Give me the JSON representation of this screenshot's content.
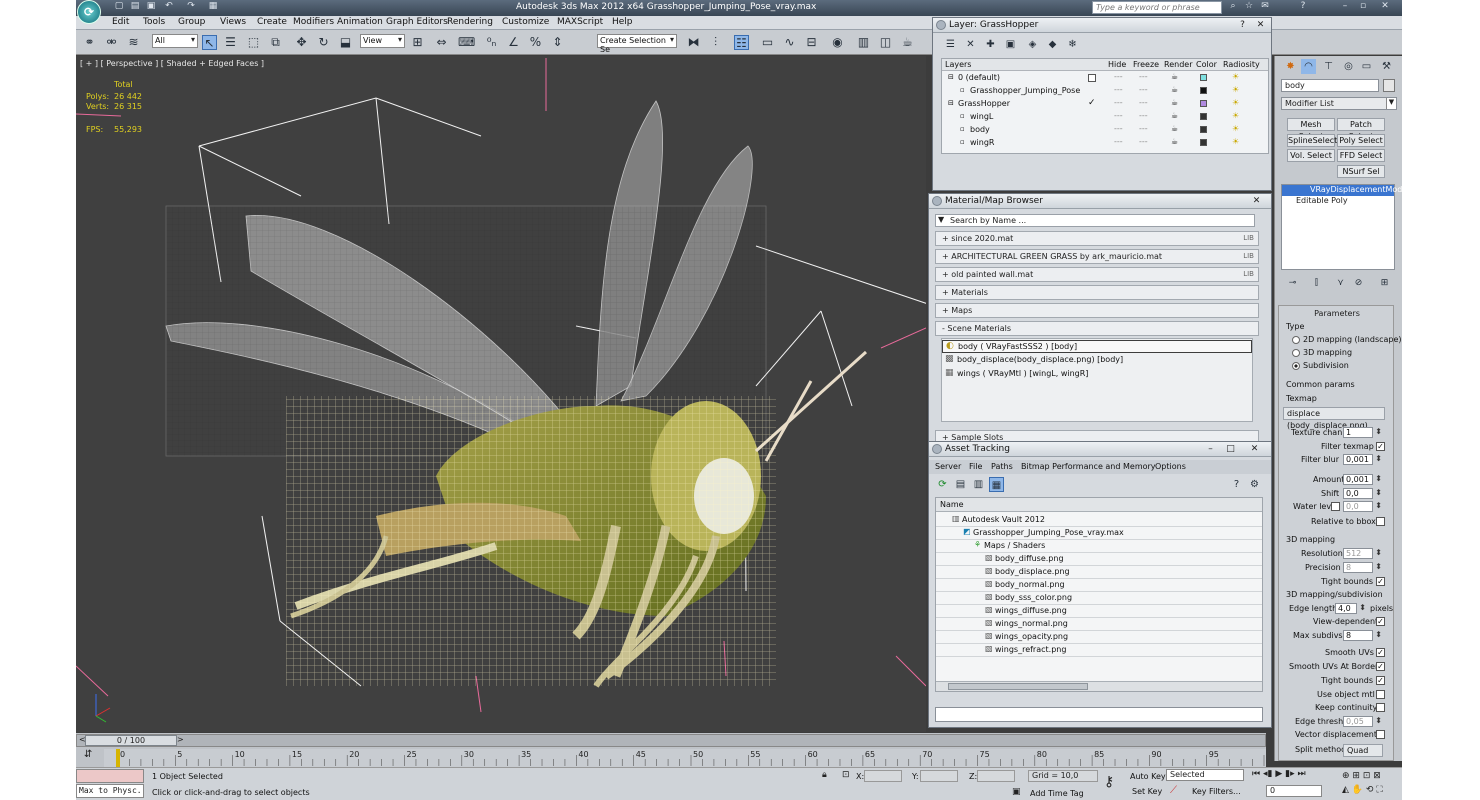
{
  "window": {
    "title": "Autodesk 3ds Max  2012 x64     Grasshopper_Jumping_Pose_vray.max",
    "search_placeholder": "Type a keyword or phrase"
  },
  "menu": [
    "Edit",
    "Tools",
    "Group",
    "Views",
    "Create",
    "Modifiers",
    "Animation",
    "Graph Editors",
    "Rendering",
    "Customize",
    "MAXScript",
    "Help"
  ],
  "toolbar": {
    "filter": "All",
    "coord": "View",
    "selection_set": "Create Selection Se"
  },
  "viewport": {
    "label": "[ + ] [ Perspective ] [ Shaded + Edged Faces ]",
    "stats_header": "Total",
    "polys_label": "Polys:",
    "polys_value": "26 442",
    "verts_label": "Verts:",
    "verts_value": "26 315",
    "fps_label": "FPS:",
    "fps_value": "55,293"
  },
  "layer_panel": {
    "title": "Layer: GrassHopper",
    "columns": [
      "Layers",
      "Hide",
      "Freeze",
      "Render",
      "Color",
      "Radiosity"
    ],
    "rows": [
      {
        "name": "0 (default)",
        "indent": 0,
        "color": "#7fe0e0"
      },
      {
        "name": "Grasshopper_Jumping_Pose",
        "indent": 1,
        "color": "#111111"
      },
      {
        "name": "GrassHopper",
        "indent": 0,
        "color": "#b08ae0"
      },
      {
        "name": "wingL",
        "indent": 1,
        "color": "#333333"
      },
      {
        "name": "body",
        "indent": 1,
        "color": "#333333"
      },
      {
        "name": "wingR",
        "indent": 1,
        "color": "#333333"
      }
    ]
  },
  "material_browser": {
    "title": "Material/Map Browser",
    "search": "Search by Name ...",
    "groups": [
      {
        "label": "+ since 2020.mat",
        "tag": "LIB"
      },
      {
        "label": "+ ARCHITECTURAL GREEN GRASS by ark_mauricio.mat",
        "tag": "LIB"
      },
      {
        "label": "+ old painted wall.mat",
        "tag": "LIB"
      },
      {
        "label": "+ Materials",
        "tag": ""
      },
      {
        "label": "+ Maps",
        "tag": ""
      },
      {
        "label": "- Scene Materials",
        "tag": ""
      }
    ],
    "scene_materials": [
      "body  ( VRayFastSSS2 )  [body]",
      "body_displace(body_displace.png) [body]",
      "wings  ( VRayMtl )  [wingL, wingR]"
    ],
    "sample_slots": "+ Sample Slots"
  },
  "asset_tracking": {
    "title": "Asset Tracking",
    "menu": [
      "Server",
      "File",
      "Paths",
      "Bitmap Performance and Memory",
      "Options"
    ],
    "column": "Name",
    "tree": [
      {
        "name": "Autodesk Vault 2012",
        "indent": 0
      },
      {
        "name": "Grasshopper_Jumping_Pose_vray.max",
        "indent": 1
      },
      {
        "name": "Maps / Shaders",
        "indent": 2
      },
      {
        "name": "body_diffuse.png",
        "indent": 3
      },
      {
        "name": "body_displace.png",
        "indent": 3
      },
      {
        "name": "body_normal.png",
        "indent": 3
      },
      {
        "name": "body_sss_color.png",
        "indent": 3
      },
      {
        "name": "wings_diffuse.png",
        "indent": 3
      },
      {
        "name": "wings_normal.png",
        "indent": 3
      },
      {
        "name": "wings_opacity.png",
        "indent": 3
      },
      {
        "name": "wings_refract.png",
        "indent": 3
      }
    ]
  },
  "command_panel": {
    "object_name": "body",
    "modifier_list": "Modifier List",
    "buttons": [
      "Mesh Select",
      "Patch Select",
      "SplineSelect",
      "Poly Select",
      "Vol. Select",
      "FFD Select",
      "NSurf Sel"
    ],
    "stack": [
      "VRayDisplacementMod",
      "Editable Poly"
    ],
    "parameters": {
      "title": "Parameters",
      "type_label": "Type",
      "type_options": [
        "2D mapping (landscape)",
        "3D mapping",
        "Subdivision"
      ],
      "selected_type": 2,
      "common_params": "Common params",
      "texmap": "Texmap",
      "texmap_value": "displace (body_displace.png)",
      "texture_chan": "Texture chan",
      "texture_chan_value": "1",
      "filter_texmap": "Filter texmap",
      "filter_blur": "Filter blur",
      "filter_blur_value": "0,001",
      "amount": "Amount",
      "amount_value": "0,001",
      "shift": "Shift",
      "shift_value": "0,0",
      "water_level": "Water level",
      "water_level_value": "0,0",
      "relative_bbox": "Relative to bbox",
      "mapping_3d": "3D mapping",
      "resolution": "Resolution",
      "resolution_value": "512",
      "precision": "Precision",
      "precision_value": "8",
      "tight_bounds": "Tight bounds",
      "subdivision": "3D mapping/subdivision",
      "edge_length": "Edge length",
      "edge_length_value": "4,0",
      "pixels": "pixels",
      "view_dependent": "View-dependent",
      "max_subdivs": "Max subdivs",
      "max_subdivs_value": "8",
      "smooth_uvs": "Smooth UVs",
      "smooth_uvs_borders": "Smooth UVs At Borders",
      "tight_bounds2": "Tight bounds",
      "use_object_mtl": "Use object mtl",
      "keep_continuity": "Keep continuity",
      "edge_thresh": "Edge thresh",
      "edge_thresh_value": "0,05",
      "vector_displacement": "Vector displacement",
      "split_method": "Split method",
      "split_method_value": "Quad"
    }
  },
  "timeline": {
    "frame": "0 / 100",
    "ticks": [
      "0",
      "5",
      "10",
      "15",
      "20",
      "25",
      "30",
      "35",
      "40",
      "45",
      "50",
      "55",
      "60",
      "65",
      "70",
      "75",
      "80",
      "85",
      "90",
      "95",
      "100"
    ]
  },
  "status": {
    "script_label": "Max to Physc.",
    "selected": "1 Object Selected",
    "prompt": "Click or click-and-drag to select objects",
    "x_label": "X:",
    "y_label": "Y:",
    "z_label": "Z:",
    "grid": "Grid = 10,0",
    "add_time_tag": "Add Time Tag",
    "auto_key": "Auto Key",
    "set_key": "Set Key",
    "selected_dd": "Selected",
    "key_filters": "Key Filters...",
    "frame_value": "0"
  }
}
